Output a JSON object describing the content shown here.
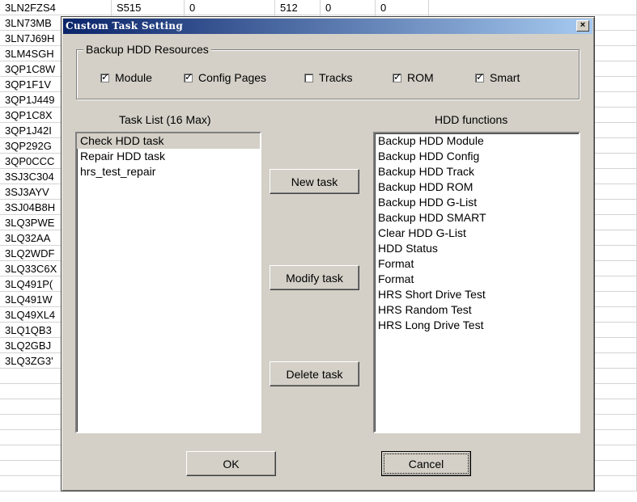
{
  "sheet": {
    "rows": [
      [
        "3LN2FZS4",
        "S515",
        "0",
        "512",
        "0",
        "0"
      ],
      [
        "3LN73MB",
        "",
        "",
        "",
        "",
        ""
      ],
      [
        "3LN7J69H",
        "",
        "",
        "",
        "",
        ""
      ],
      [
        "3LM4SGH",
        "",
        "",
        "",
        "",
        ""
      ],
      [
        "3QP1C8W",
        "",
        "",
        "",
        "",
        ""
      ],
      [
        "3QP1F1V",
        "",
        "",
        "",
        "",
        ""
      ],
      [
        "3QP1J449",
        "",
        "",
        "",
        "",
        ""
      ],
      [
        "3QP1C8X",
        "",
        "",
        "",
        "",
        ""
      ],
      [
        "3QP1J42I",
        "",
        "",
        "",
        "",
        ""
      ],
      [
        "3QP292G",
        "",
        "",
        "",
        "",
        ""
      ],
      [
        "3QP0CCC",
        "",
        "",
        "",
        "",
        ""
      ],
      [
        "3SJ3C304",
        "",
        "",
        "",
        "",
        ""
      ],
      [
        "3SJ3AYV",
        "",
        "",
        "",
        "",
        ""
      ],
      [
        "3SJ04B8H",
        "",
        "",
        "",
        "",
        ""
      ],
      [
        "3LQ3PWE",
        "",
        "",
        "",
        "",
        ""
      ],
      [
        "3LQ32AA",
        "",
        "",
        "",
        "",
        ""
      ],
      [
        "3LQ2WDF",
        "",
        "",
        "",
        "",
        ""
      ],
      [
        "3LQ33C6X",
        "",
        "",
        "",
        "",
        ""
      ],
      [
        "3LQ491P(",
        "",
        "",
        "",
        "",
        ""
      ],
      [
        "3LQ491W",
        "",
        "",
        "",
        "",
        ""
      ],
      [
        "3LQ49XL4",
        "",
        "",
        "",
        "",
        ""
      ],
      [
        "3LQ1QB3",
        "",
        "",
        "",
        "",
        ""
      ],
      [
        "3LQ2GBJ",
        "",
        "",
        "",
        "",
        ""
      ],
      [
        "3LQ3ZG3'",
        "",
        "",
        "",
        "",
        ""
      ],
      [
        "",
        "",
        "",
        "",
        "",
        ""
      ],
      [
        "",
        "",
        "",
        "",
        "",
        ""
      ],
      [
        "",
        "",
        "",
        "",
        "",
        ""
      ],
      [
        "",
        "",
        "",
        "",
        "",
        ""
      ],
      [
        "",
        "",
        "",
        "",
        "",
        ""
      ],
      [
        "",
        "",
        "",
        "",
        "",
        ""
      ],
      [
        "",
        "",
        "",
        "",
        "",
        ""
      ],
      [
        "",
        "",
        "",
        "",
        "",
        ""
      ]
    ]
  },
  "dialog": {
    "title": "Custom Task Setting",
    "close_glyph": "×"
  },
  "backup": {
    "group_label": "Backup HDD Resources",
    "options": [
      {
        "label": "Module",
        "checked": true
      },
      {
        "label": "Config Pages",
        "checked": true
      },
      {
        "label": "Tracks",
        "checked": false
      },
      {
        "label": "ROM",
        "checked": true
      },
      {
        "label": "Smart",
        "checked": true
      }
    ]
  },
  "task_list": {
    "label": "Task List (16 Max)",
    "items": [
      "Check HDD task",
      "Repair HDD task",
      "hrs_test_repair"
    ],
    "selected_index": 0
  },
  "hdd_functions": {
    "label": "HDD functions",
    "items": [
      "Backup HDD Module",
      "Backup HDD Config",
      "Backup HDD Track",
      "Backup HDD ROM",
      "Backup HDD G-List",
      "Backup HDD SMART",
      "Clear HDD G-List",
      "HDD Status",
      "Format",
      "Format",
      "HRS Short Drive Test",
      "HRS Random Test",
      "HRS Long Drive Test"
    ]
  },
  "buttons": {
    "new_task": "New task",
    "modify_task": "Modify task",
    "delete_task": "Delete task",
    "ok": "OK",
    "cancel": "Cancel"
  },
  "colors": {
    "titlebar_start": "#0a246a",
    "titlebar_end": "#a6caf0",
    "dialog_face": "#d4d0c8"
  }
}
